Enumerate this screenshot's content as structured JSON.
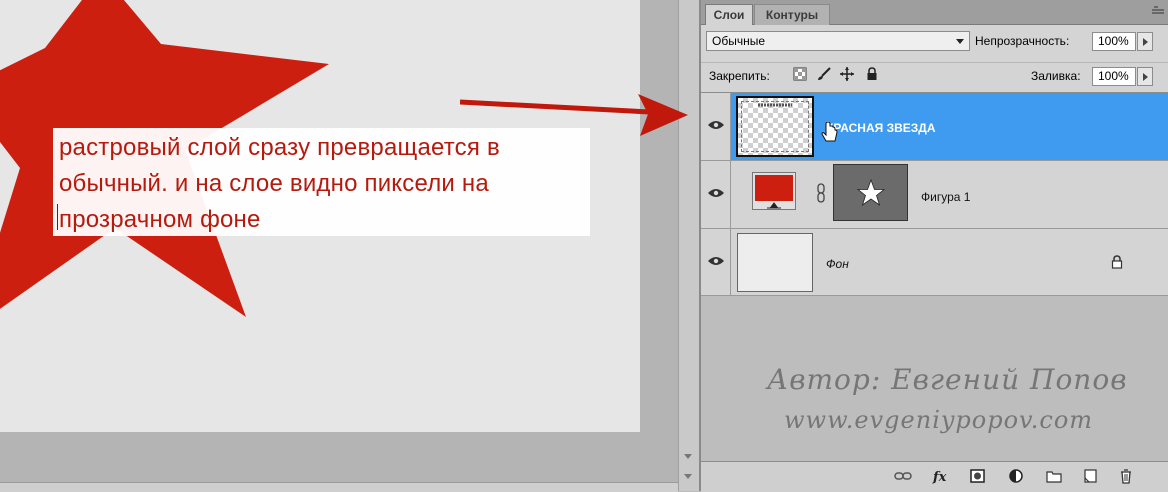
{
  "caption": {
    "lines": [
      "растровый слой сразу превращается в",
      "обычный. и на слое видно пиксели на",
      "прозрачном фоне"
    ]
  },
  "panel": {
    "tabs": [
      {
        "label": "Слои",
        "active": true
      },
      {
        "label": "Контуры",
        "active": false
      }
    ],
    "blend_mode": "Обычные",
    "opacity_label": "Непрозрачность:",
    "opacity_value": "100%",
    "lock_label": "Закрепить:",
    "fill_label": "Заливка:",
    "fill_value": "100%",
    "layers": [
      {
        "name": "КРАСНАЯ ЗВЕЗДА",
        "visible": true,
        "selected": true
      },
      {
        "name": "Фигура 1",
        "visible": true,
        "selected": false
      },
      {
        "name": "Фон",
        "visible": true,
        "selected": false,
        "locked": true
      }
    ],
    "watermark": {
      "line1": "Автор: Евгений Попов",
      "line2": "www.evgeniypopov.com"
    },
    "bottom_tools": [
      "link-layers-icon",
      "fx-icon",
      "add-mask-icon",
      "adjustment-layer-icon",
      "new-group-icon",
      "new-layer-icon",
      "trash-icon"
    ]
  },
  "colors": {
    "star_red": "#cc1f10",
    "selection_blue": "#3f9bf0",
    "caption_text": "#b51a0d"
  }
}
